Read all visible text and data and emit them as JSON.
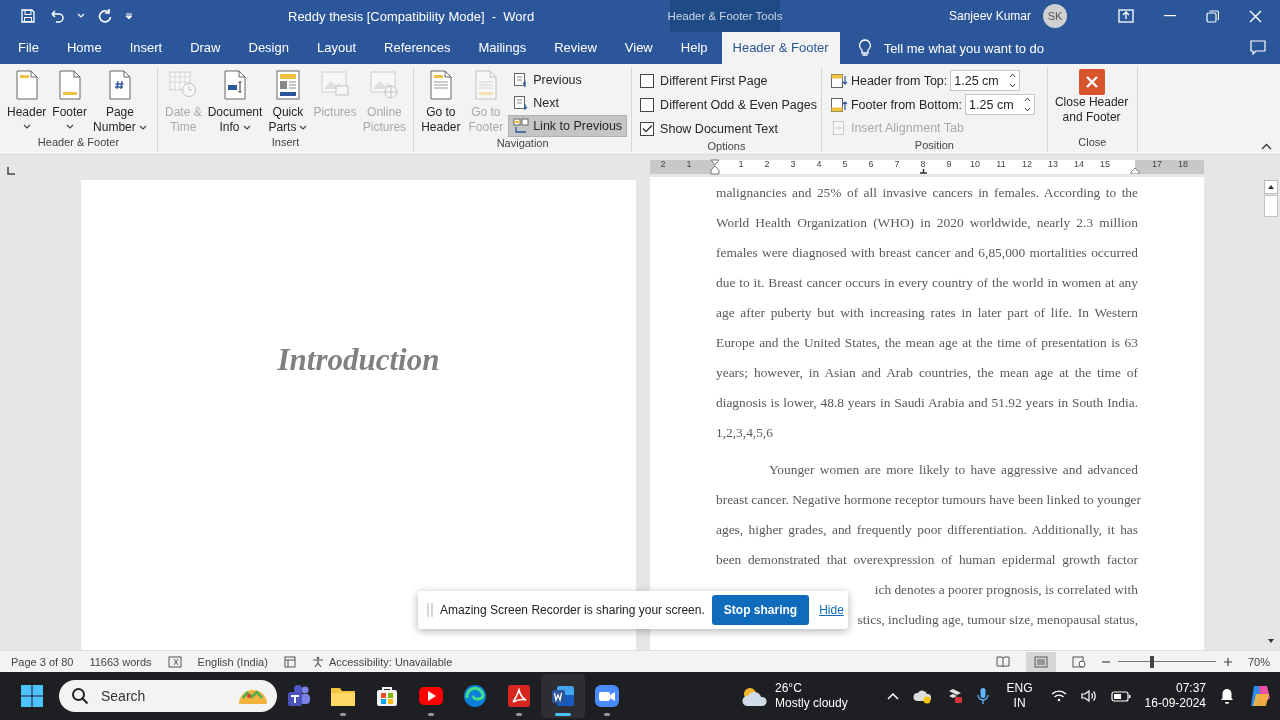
{
  "title_bar": {
    "document_title": "Reddy thesis [Compatibility Mode]  -  Word",
    "context_label": "Header & Footer Tools",
    "user_name": "Sanjeev Kumar",
    "user_initials": "SK"
  },
  "tabs": [
    {
      "label": "File",
      "selected": false
    },
    {
      "label": "Home",
      "selected": false
    },
    {
      "label": "Insert",
      "selected": false
    },
    {
      "label": "Draw",
      "selected": false
    },
    {
      "label": "Design",
      "selected": false
    },
    {
      "label": "Layout",
      "selected": false
    },
    {
      "label": "References",
      "selected": false
    },
    {
      "label": "Mailings",
      "selected": false
    },
    {
      "label": "Review",
      "selected": false
    },
    {
      "label": "View",
      "selected": false
    },
    {
      "label": "Help",
      "selected": false
    },
    {
      "label": "Header & Footer",
      "selected": true
    }
  ],
  "tell_me": {
    "placeholder": "Tell me what you want to do"
  },
  "ribbon": {
    "groups": [
      {
        "label": "Header & Footer",
        "items": [
          {
            "kind": "large",
            "lines": [
              "Header"
            ],
            "dropdown": true,
            "disabled": false
          },
          {
            "kind": "large",
            "lines": [
              "Footer"
            ],
            "dropdown": true,
            "disabled": false
          },
          {
            "kind": "large",
            "lines": [
              "Page",
              "Number"
            ],
            "dropdown": true,
            "disabled": false
          }
        ]
      },
      {
        "label": "Insert",
        "items": [
          {
            "kind": "large",
            "lines": [
              "Date &",
              "Time"
            ],
            "dropdown": false,
            "disabled": true
          },
          {
            "kind": "large",
            "lines": [
              "Document",
              "Info"
            ],
            "dropdown": true,
            "disabled": false
          },
          {
            "kind": "large",
            "lines": [
              "Quick",
              "Parts"
            ],
            "dropdown": true,
            "disabled": false
          },
          {
            "kind": "large",
            "lines": [
              "Pictures"
            ],
            "dropdown": false,
            "disabled": true
          },
          {
            "kind": "large",
            "lines": [
              "Online",
              "Pictures"
            ],
            "dropdown": false,
            "disabled": true
          }
        ]
      },
      {
        "label": "Navigation",
        "items": [
          {
            "kind": "large",
            "lines": [
              "Go to",
              "Header"
            ],
            "dropdown": false,
            "disabled": false
          },
          {
            "kind": "large",
            "lines": [
              "Go to",
              "Footer"
            ],
            "dropdown": false,
            "disabled": true
          },
          {
            "kind": "small",
            "label": "Previous",
            "selected": false
          },
          {
            "kind": "small",
            "label": "Next",
            "selected": false
          },
          {
            "kind": "small",
            "label": "Link to Previous",
            "selected": true
          }
        ]
      },
      {
        "label": "Options",
        "items": [
          {
            "kind": "check",
            "label": "Different First Page",
            "checked": false
          },
          {
            "kind": "check",
            "label": "Different Odd & Even Pages",
            "checked": false
          },
          {
            "kind": "check",
            "label": "Show Document Text",
            "checked": true
          }
        ]
      },
      {
        "label": "Position",
        "items": [
          {
            "kind": "spin",
            "label": "Header from Top:",
            "value": "1.25 cm"
          },
          {
            "kind": "spin",
            "label": "Footer from Bottom:",
            "value": "1.25 cm"
          },
          {
            "kind": "smalldisabled",
            "label": "Insert Alignment Tab"
          }
        ]
      },
      {
        "label": "Close",
        "items": [
          {
            "kind": "close",
            "lines": [
              "Close Header",
              "and Footer"
            ]
          }
        ]
      }
    ]
  },
  "ruler": {
    "labels": [
      "2",
      "1",
      "1",
      "2",
      "3",
      "4",
      "5",
      "6",
      "7",
      "8",
      "9",
      "10",
      "11",
      "12",
      "13",
      "14",
      "15",
      "17",
      "18"
    ]
  },
  "left_page": {
    "heading": "Introduction"
  },
  "right_page": {
    "paragraphs": [
      {
        "indent": false,
        "lines": [
          {
            "kind": "full",
            "text": "malignancies and 25% of all invasive cancers in females. According to the"
          },
          {
            "kind": "full",
            "text": "World Health Organization (WHO) in 2020 worldwide, nearly 2.3 million"
          },
          {
            "kind": "full",
            "text": "females were diagnosed with breast cancer and 6,85,000 mortalities occurred"
          },
          {
            "kind": "full",
            "text": "due to it. Breast cancer occurs in every country of the world in women at any"
          },
          {
            "kind": "full",
            "text": "age after puberty but with increasing rates in later part of life. In Western"
          },
          {
            "kind": "full",
            "text": "Europe and the United States, the mean age at the time of presentation is 63"
          },
          {
            "kind": "full",
            "text": "years; however, in Asian and Arab countries, the mean age at the time of"
          },
          {
            "kind": "full",
            "text": "diagnosis is lower, 48.8 years in Saudi Arabia and 51.92 years in South India."
          },
          {
            "kind": "last",
            "text": "1,2,3,4,5,6"
          }
        ]
      },
      {
        "indent": true,
        "lines": [
          {
            "kind": "full",
            "text": "Younger women are more likely to have aggressive and advanced"
          },
          {
            "kind": "full",
            "text": "breast cancer. Negative hormone receptor tumours have been linked to younger"
          },
          {
            "kind": "full",
            "text": "ages, higher grades, and frequently poor differentiation. Additionally, it has"
          },
          {
            "kind": "full",
            "text": "been demonstrated that overexpression of human epidermal growth factor"
          },
          {
            "kind": "covered",
            "text": "ich denotes a poorer prognosis, is correlated with"
          },
          {
            "kind": "covered",
            "text": "stics, including age, tumour size, menopausal status,"
          }
        ]
      }
    ]
  },
  "share_bar": {
    "message": "Amazing Screen Recorder is sharing your screen.",
    "stop_label": "Stop sharing",
    "hide_label": "Hide"
  },
  "status_bar": {
    "page": "Page 3 of 80",
    "words": "11663 words",
    "language": "English (India)",
    "accessibility": "Accessibility: Unavailable",
    "views": [
      {
        "kind": "read",
        "selected": false
      },
      {
        "kind": "print",
        "selected": true
      },
      {
        "kind": "web",
        "selected": false
      }
    ],
    "zoom": {
      "level": 0.35,
      "reading": "70%"
    }
  },
  "taskbar": {
    "search": {
      "placeholder": "Search"
    },
    "apps": [
      {
        "kind": "teams",
        "running": false,
        "active": false
      },
      {
        "kind": "explorer",
        "running": true,
        "active": false
      },
      {
        "kind": "store",
        "running": false,
        "active": false
      },
      {
        "kind": "youtube",
        "running": true,
        "active": false
      },
      {
        "kind": "edge",
        "running": false,
        "active": false
      },
      {
        "kind": "acrobat",
        "running": true,
        "active": false
      },
      {
        "kind": "word",
        "running": true,
        "active": true
      },
      {
        "kind": "video",
        "running": true,
        "active": false
      }
    ],
    "weather": {
      "temperature": "26°C",
      "condition": "Mostly cloudy"
    },
    "input": {
      "language": "ENG",
      "region": "IN"
    },
    "clock": {
      "time": "07:37",
      "date": "16-09-2024"
    }
  }
}
